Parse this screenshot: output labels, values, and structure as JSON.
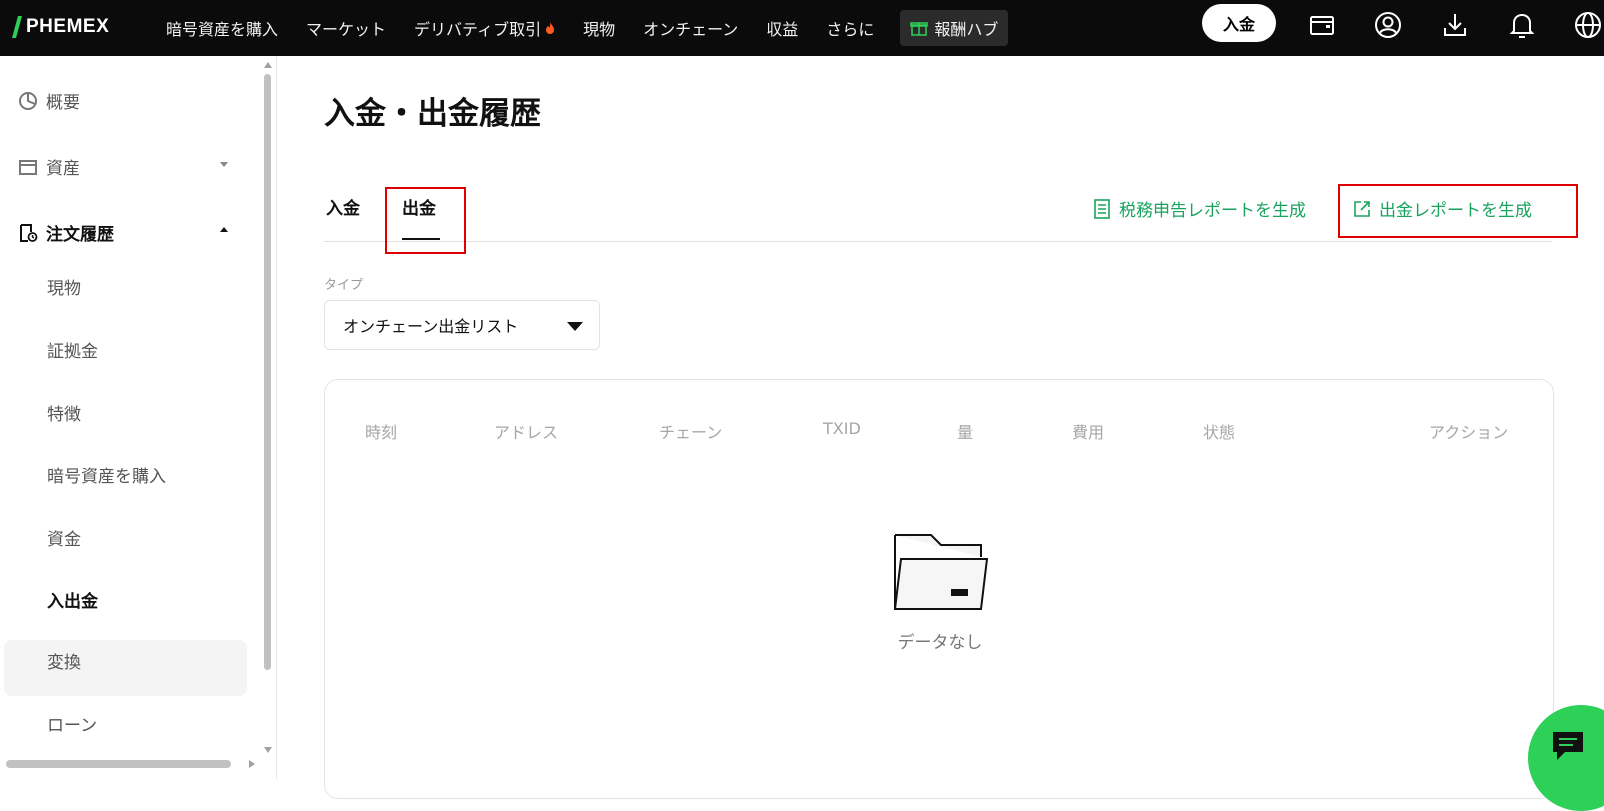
{
  "brand": {
    "name": "PHEMEX",
    "accent_color": "#19a35f",
    "highlight_color": "#e00000"
  },
  "nav": {
    "items": [
      "暗号資産を購入",
      "マーケット",
      "デリバティブ取引",
      "現物",
      "オンチェーン",
      "収益",
      "さらに"
    ],
    "reward_hub": "報酬ハブ",
    "deposit_button": "入金"
  },
  "top_icons": [
    "wallet-icon",
    "user-icon",
    "download-icon",
    "bell-icon",
    "globe-icon"
  ],
  "sidebar": {
    "overview": "概要",
    "assets": "資産",
    "order_history": "注文履歴",
    "sub_items": [
      "現物",
      "証拠金",
      "特徴",
      "暗号資産を購入",
      "資金",
      "入出金",
      "変換",
      "ローン"
    ],
    "active_sub_item": "入出金"
  },
  "main": {
    "title": "入金・出金履歴",
    "tabs": {
      "deposit": "入金",
      "withdraw": "出金",
      "active": "出金"
    },
    "tax_report_link": "税務申告レポートを生成",
    "withdraw_report_link": "出金レポートを生成",
    "type_label": "タイプ",
    "type_select_value": "オンチェーン出金リスト",
    "table_headers": [
      "時刻",
      "アドレス",
      "チェーン",
      "TXID",
      "量",
      "費用",
      "状態",
      "アクション"
    ],
    "empty_text": "データなし"
  }
}
